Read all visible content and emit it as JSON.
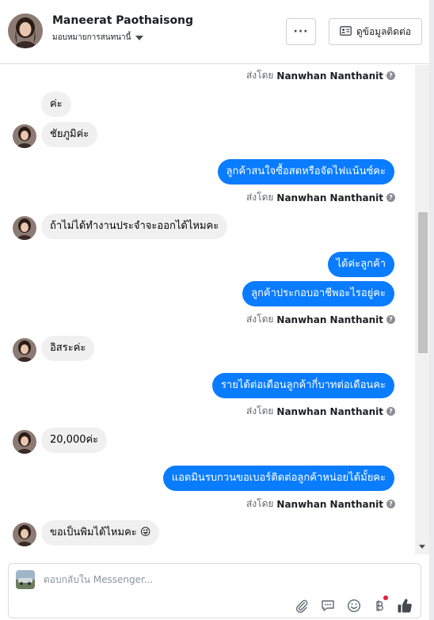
{
  "header": {
    "contact_name": "Maneerat Paothaisong",
    "assign_label": "มอบหมายการสนทนานี้",
    "more_label": "···",
    "contact_info_label": "ดูข้อมูลติดต่อ"
  },
  "sent_by_prefix": "ส่งโดย",
  "sent_by_agent": "Nanwhan Nanthanit",
  "messages": [
    {
      "dir": "in",
      "text": "ค่ะ"
    },
    {
      "dir": "in",
      "text": "ชัยภูมิค่ะ"
    },
    {
      "dir": "out",
      "text": "ลูกค้าสนใจซื้อสดหรือจัดไฟแน้นซ์คะ"
    },
    {
      "dir": "in",
      "text": "ถ้าไม่ได้ทำงานประจำจะออกได้ไหมคะ"
    },
    {
      "dir": "out",
      "text": "ได้ค่ะลูกค้า"
    },
    {
      "dir": "out",
      "text": "ลูกค้าประกอบอาชีพอะไรอยู่คะ"
    },
    {
      "dir": "in",
      "text": "อิสระค่ะ"
    },
    {
      "dir": "out",
      "text": "รายได้ต่อเดือนลูกค้ากี่บาทต่อเดือนคะ"
    },
    {
      "dir": "in",
      "text": "20,000ค่ะ"
    },
    {
      "dir": "out",
      "text": "แอดมินรบกวนขอเบอร์ติดต่อลูกค้าหน่อยได้มั้ยคะ"
    },
    {
      "dir": "in",
      "text": "ขอเป็นพิมได้ไหมคะ 😜"
    }
  ],
  "composer": {
    "placeholder": "ตอบกลับใน Messenger..."
  },
  "toolbar_icons": [
    "paperclip-icon",
    "saved-reply-icon",
    "emoji-icon",
    "baht-icon",
    "thumbs-up-icon"
  ],
  "colors": {
    "outgoing_bubble": "#0a7cff",
    "incoming_bubble": "#f1f0f0",
    "like_button": "#444950",
    "notification_dot": "#e41e3f"
  }
}
